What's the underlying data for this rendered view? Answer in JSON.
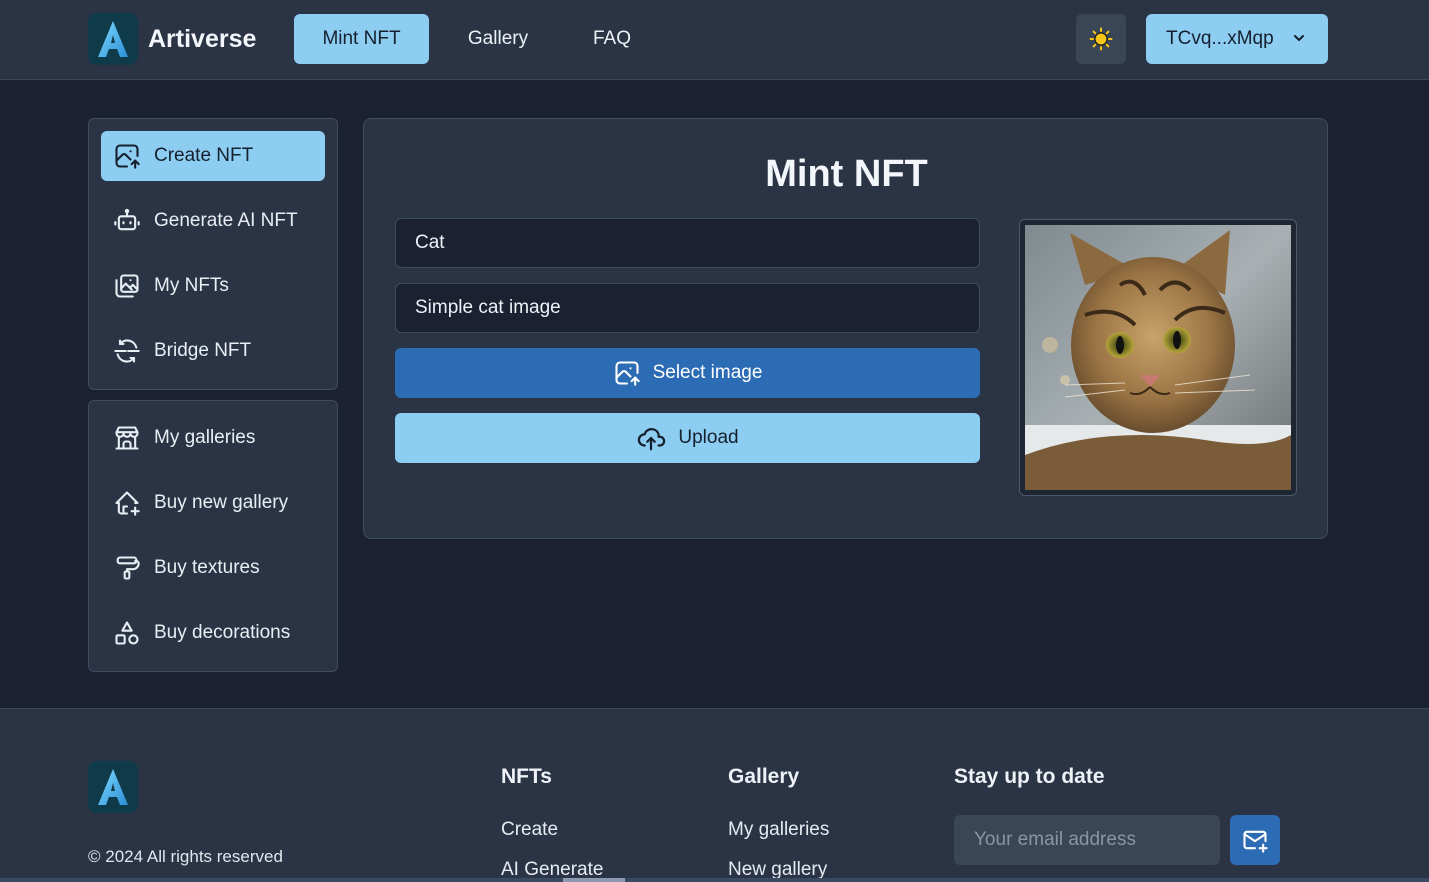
{
  "header": {
    "brand": "Artiverse",
    "nav": {
      "mint": "Mint NFT",
      "gallery": "Gallery",
      "faq": "FAQ"
    },
    "theme_icon": "sun-icon",
    "wallet": "TCvq...xMqp"
  },
  "sidebar": {
    "group1": [
      {
        "label": "Create NFT",
        "icon": "image-upload-icon",
        "active": true
      },
      {
        "label": "Generate AI NFT",
        "icon": "robot-icon"
      },
      {
        "label": "My NFTs",
        "icon": "photos-icon"
      },
      {
        "label": "Bridge NFT",
        "icon": "bridge-icon"
      }
    ],
    "group2": [
      {
        "label": "My galleries",
        "icon": "building-store-icon"
      },
      {
        "label": "Buy new gallery",
        "icon": "home-plus-icon"
      },
      {
        "label": "Buy textures",
        "icon": "paint-roller-icon"
      },
      {
        "label": "Buy decorations",
        "icon": "shapes-icon"
      }
    ]
  },
  "mint": {
    "title": "Mint NFT",
    "name_value": "Cat",
    "description_value": "Simple cat image",
    "select_label": "Select image",
    "upload_label": "Upload"
  },
  "footer": {
    "copyright": "© 2024 All rights reserved",
    "nfts_heading": "NFTs",
    "nfts_links": [
      "Create",
      "AI Generate"
    ],
    "gallery_heading": "Gallery",
    "gallery_links": [
      "My galleries",
      "New gallery"
    ],
    "newsletter_heading": "Stay up to date",
    "email_placeholder": "Your email address"
  },
  "colors": {
    "accent": "#8ecdf2",
    "primary_button": "#2c6cb4",
    "background": "#1b2131",
    "panel": "#2b3445"
  }
}
